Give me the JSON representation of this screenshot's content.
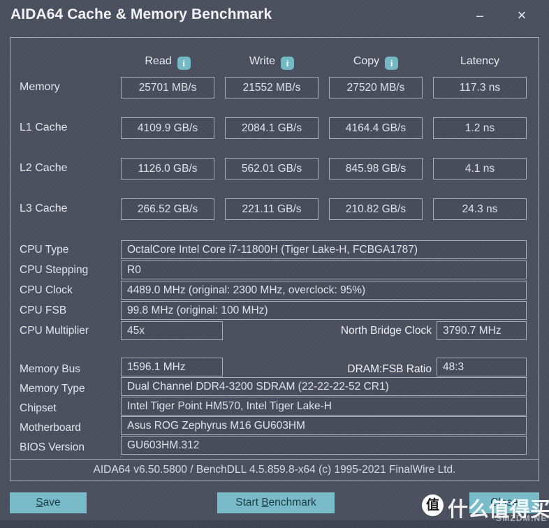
{
  "window": {
    "title": "AIDA64 Cache & Memory Benchmark",
    "minimize_label": "–",
    "close_label": "×"
  },
  "benchmark": {
    "columns": [
      {
        "label": "Read",
        "info": "i"
      },
      {
        "label": "Write",
        "info": "i"
      },
      {
        "label": "Copy",
        "info": "i"
      },
      {
        "label": "Latency",
        "info": ""
      }
    ],
    "rows": [
      {
        "label": "Memory",
        "read": "25701 MB/s",
        "write": "21552 MB/s",
        "copy": "27520 MB/s",
        "latency": "117.3 ns"
      },
      {
        "label": "L1 Cache",
        "read": "4109.9 GB/s",
        "write": "2084.1 GB/s",
        "copy": "4164.4 GB/s",
        "latency": "1.2 ns"
      },
      {
        "label": "L2 Cache",
        "read": "1126.0 GB/s",
        "write": "562.01 GB/s",
        "copy": "845.98 GB/s",
        "latency": "4.1 ns"
      },
      {
        "label": "L3 Cache",
        "read": "266.52 GB/s",
        "write": "221.11 GB/s",
        "copy": "210.82 GB/s",
        "latency": "24.3 ns"
      }
    ]
  },
  "cpu_info": {
    "cpu_type_label": "CPU Type",
    "cpu_type_value": "OctalCore Intel Core i7-11800H  (Tiger Lake-H, FCBGA1787)",
    "cpu_stepping_label": "CPU Stepping",
    "cpu_stepping_value": "R0",
    "cpu_clock_label": "CPU Clock",
    "cpu_clock_value": "4489.0 MHz  (original: 2300 MHz, overclock: 95%)",
    "cpu_fsb_label": "CPU FSB",
    "cpu_fsb_value": "99.8 MHz  (original: 100 MHz)",
    "cpu_multiplier_label": "CPU Multiplier",
    "cpu_multiplier_value": "45x",
    "north_bridge_label": "North Bridge Clock",
    "north_bridge_value": "3790.7 MHz"
  },
  "system_info": {
    "memory_bus_label": "Memory Bus",
    "memory_bus_value": "1596.1 MHz",
    "dram_fsb_label": "DRAM:FSB Ratio",
    "dram_fsb_value": "48:3",
    "memory_type_label": "Memory Type",
    "memory_type_value": "Dual Channel DDR4-3200 SDRAM  (22-22-22-52 CR1)",
    "chipset_label": "Chipset",
    "chipset_value": "Intel Tiger Point HM570, Intel Tiger Lake-H",
    "motherboard_label": "Motherboard",
    "motherboard_value": "Asus ROG Zephyrus M16 GU603HM",
    "bios_label": "BIOS Version",
    "bios_value": "GU603HM.312"
  },
  "footer": {
    "version_text": "AIDA64 v6.50.5800 / BenchDLL 4.5.859.8-x64  (c) 1995-2021 FinalWire Ltd.",
    "save_label": "Save",
    "save_accel": "S",
    "save_rest": "ave",
    "start_label": "Start Benchmark",
    "start_pre": "Start ",
    "start_accel": "B",
    "start_rest": "enchmark",
    "close_label": "Close"
  },
  "watermark": {
    "badge": "值",
    "text": "什么值得买",
    "sub": "SMZDM.NET"
  },
  "colors": {
    "window_bg": "#4a505e",
    "panel_border": "#a8adb8",
    "box_bg": "#474d5b",
    "box_border": "#aab0ba",
    "text": "#e3e7ee",
    "accent_button": "#79bcc9",
    "info_icon": "#74b9c6"
  }
}
